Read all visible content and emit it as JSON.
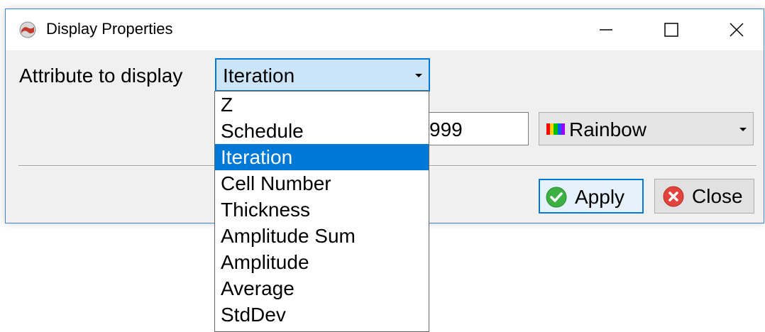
{
  "window": {
    "title": "Display Properties",
    "minimize_icon": "minimize-icon",
    "maximize_icon": "maximize-icon",
    "close_icon": "close-icon"
  },
  "attribute": {
    "label": "Attribute to display",
    "selected": "Iteration",
    "options": [
      "Z",
      "Schedule",
      "Iteration",
      "Cell Number",
      "Thickness",
      "Amplitude Sum",
      "Amplitude",
      "Average",
      "StdDev"
    ],
    "highlighted_index": 2
  },
  "range": {
    "max_value": "999"
  },
  "colormap": {
    "selected": "Rainbow",
    "swatch_colors": [
      "#ff0000",
      "#ffd400",
      "#00c000",
      "#0060ff",
      "#a000ff"
    ]
  },
  "buttons": {
    "apply_label": "Apply",
    "close_label": "Close"
  },
  "colors": {
    "accent": "#0078d7",
    "apply_icon": "#3cb043",
    "close_icon": "#e2433b"
  }
}
